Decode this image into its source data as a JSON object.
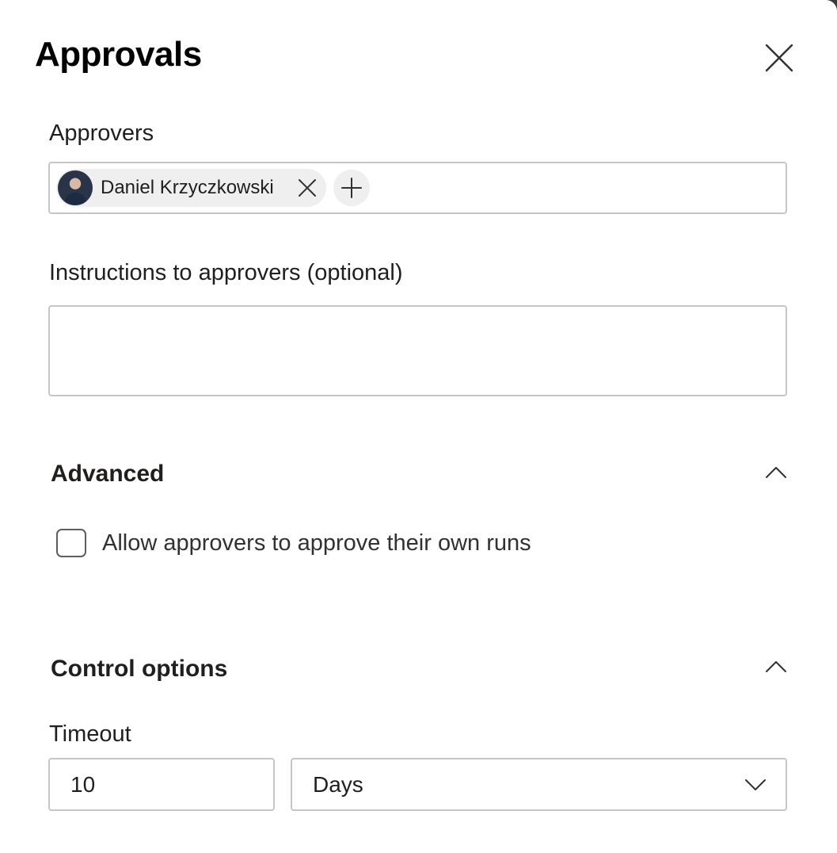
{
  "dialog": {
    "title": "Approvals",
    "close_icon": "close-icon"
  },
  "approvers": {
    "label": "Approvers",
    "selected": [
      {
        "name": "Daniel Krzyczkowski",
        "avatar_icon": "user-avatar",
        "remove_icon": "close-icon"
      }
    ],
    "add_icon": "plus-icon"
  },
  "instructions": {
    "label": "Instructions to approvers (optional)",
    "value": "",
    "placeholder": ""
  },
  "advanced": {
    "header": "Advanced",
    "collapse_icon": "chevron-up-icon",
    "allow_self_approval": {
      "label": "Allow approvers to approve their own runs",
      "checked": false
    }
  },
  "control_options": {
    "header": "Control options",
    "collapse_icon": "chevron-up-icon",
    "timeout": {
      "label": "Timeout",
      "value": "10",
      "unit": "Days",
      "unit_icon": "chevron-down-icon"
    }
  },
  "colors": {
    "border": "#c8c6c4",
    "chip_background": "#efefef",
    "text": "#201f1e"
  }
}
